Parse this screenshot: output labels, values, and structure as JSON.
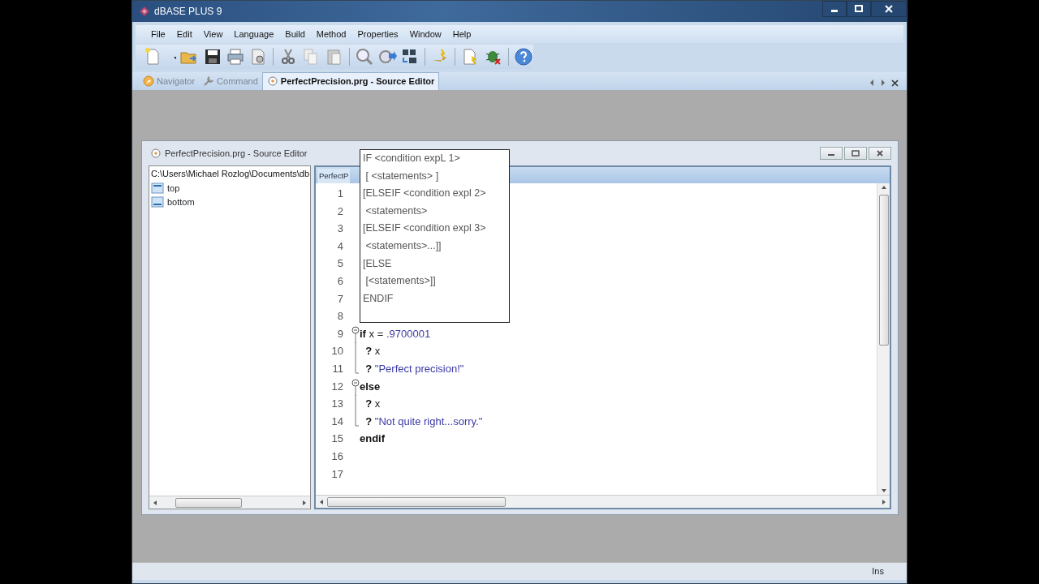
{
  "window": {
    "title": "dBASE PLUS 9"
  },
  "menu": [
    "File",
    "Edit",
    "View",
    "Language",
    "Build",
    "Method",
    "Properties",
    "Window",
    "Help"
  ],
  "tabs": [
    {
      "label": "Navigator",
      "selected": false
    },
    {
      "label": "Command",
      "selected": false
    },
    {
      "label": "PerfectPrecision.prg - Source Editor",
      "selected": true
    }
  ],
  "child_window": {
    "title": "PerfectPrecision.prg - Source Editor",
    "tree": {
      "path": "C:\\Users\\Michael Rozlog\\Documents\\db",
      "items": [
        {
          "label": "top"
        },
        {
          "label": "bottom"
        }
      ]
    },
    "editor": {
      "tab": "PerfectP",
      "lines": [
        {
          "number": "1",
          "kind": "plain"
        },
        {
          "number": "2",
          "kind": "plain"
        },
        {
          "number": "3",
          "kind": "plain"
        },
        {
          "number": "4",
          "kind": "plain"
        },
        {
          "number": "5",
          "kind": "plain"
        },
        {
          "number": "6",
          "kind": "plain"
        },
        {
          "number": "7",
          "kind": "plain"
        },
        {
          "number": "8",
          "kind": "plain"
        },
        {
          "number": "9",
          "kind": "foldstart",
          "tokens": [
            {
              "kind": "keyword",
              "text": "if"
            },
            {
              "kind": "plain",
              "text": " x = "
            },
            {
              "kind": "literal",
              "text": ".9700001"
            }
          ]
        },
        {
          "number": "10",
          "kind": "foldbody",
          "tokens": [
            {
              "kind": "keyword",
              "text": "  ?"
            },
            {
              "kind": "plain",
              "text": " x"
            }
          ]
        },
        {
          "number": "11",
          "kind": "foldend",
          "tokens": [
            {
              "kind": "keyword",
              "text": "  ?"
            },
            {
              "kind": "literal",
              "text": " \"Perfect precision!\""
            }
          ]
        },
        {
          "number": "12",
          "kind": "foldstart",
          "tokens": [
            {
              "kind": "keyword",
              "text": "else"
            }
          ]
        },
        {
          "number": "13",
          "kind": "foldbody",
          "tokens": [
            {
              "kind": "keyword",
              "text": "  ?"
            },
            {
              "kind": "plain",
              "text": " x"
            }
          ]
        },
        {
          "number": "14",
          "kind": "foldend",
          "tokens": [
            {
              "kind": "keyword",
              "text": "  ?"
            },
            {
              "kind": "literal",
              "text": " \"Not quite right...sorry.\""
            }
          ]
        },
        {
          "number": "15",
          "kind": "plain",
          "tokens": [
            {
              "kind": "keyword",
              "text": "endif"
            }
          ]
        },
        {
          "number": "16",
          "kind": "plain"
        },
        {
          "number": "17",
          "kind": "plain"
        }
      ]
    },
    "hint_popup": {
      "lines": [
        "IF <condition expL 1>",
        " [ <statements> ]",
        "[ELSEIF <condition expl 2>",
        " <statements>",
        "[ELSEIF <condition expl 3>",
        " <statements>...]]",
        "[ELSE",
        " [<statements>]]",
        "ENDIF"
      ]
    }
  },
  "status_bar": {
    "mode": "Ins"
  }
}
